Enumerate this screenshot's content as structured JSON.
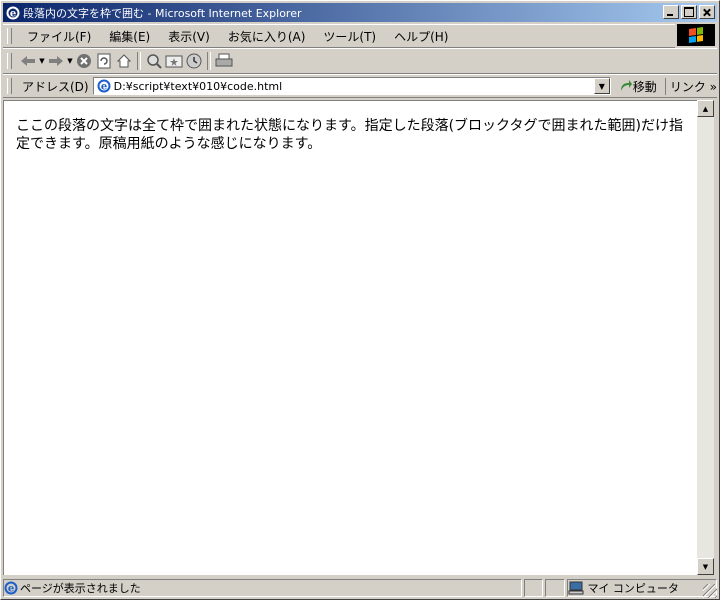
{
  "window": {
    "title": "段落内の文字を枠で囲む - Microsoft Internet Explorer"
  },
  "menu": [
    "ファイル(F)",
    "編集(E)",
    "表示(V)",
    "お気に入り(A)",
    "ツール(T)",
    "ヘルプ(H)"
  ],
  "toolbar": {
    "buttons": [
      "back-icon",
      "forward-icon",
      "stop-icon",
      "refresh-icon",
      "home-icon",
      "search-icon",
      "favorites-icon",
      "history-icon",
      "print-icon"
    ]
  },
  "address": {
    "label": "アドレス(D)",
    "value": "D:¥script¥text¥010¥code.html",
    "go_label": "移動",
    "links_label": "リンク"
  },
  "content": {
    "paragraph": "ここの段落の文字は全て枠で囲まれた状態になります。指定した段落(ブロックタグで囲まれた範囲)だけ指定できます。原稿用紙のような感じになります。"
  },
  "status": {
    "text": "ページが表示されました",
    "zone": "マイ コンピュータ"
  },
  "colors": {
    "titlebar_start": "#0a246a",
    "titlebar_end": "#a6caf0",
    "chrome": "#d4d0c8"
  }
}
